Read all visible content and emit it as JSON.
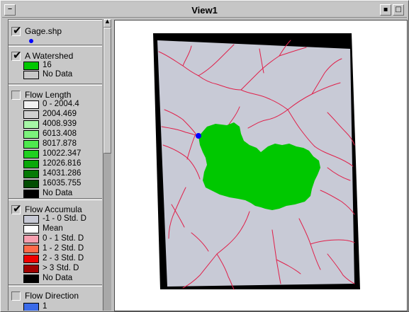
{
  "window": {
    "title": "View1"
  },
  "legend": {
    "gage": {
      "name": "Gage.shp",
      "checked": true,
      "symbol_color": "#0000ff"
    },
    "watershed": {
      "name": "A Watershed",
      "checked": true,
      "classes": [
        {
          "label": "16",
          "color": "#00c800"
        },
        {
          "label": "No Data",
          "color": "#c8c8c8"
        }
      ]
    },
    "flow_length": {
      "name": "Flow Length",
      "checked": false,
      "classes": [
        {
          "label": "0 - 2004.4",
          "color": "#f2f2f2"
        },
        {
          "label": "2004.469",
          "color": "#d0d0d0"
        },
        {
          "label": "4008.939",
          "color": "#a6f6a6"
        },
        {
          "label": "6013.408",
          "color": "#7cf27c"
        },
        {
          "label": "8017.878",
          "color": "#4ee84e"
        },
        {
          "label": "10022.347",
          "color": "#20d020"
        },
        {
          "label": "12026.816",
          "color": "#0aa80a"
        },
        {
          "label": "14031.286",
          "color": "#067a06"
        },
        {
          "label": "16035.755",
          "color": "#034e03"
        },
        {
          "label": "No Data",
          "color": "#000000"
        }
      ]
    },
    "flow_accumulation": {
      "name": "Flow Accumula",
      "checked": true,
      "classes": [
        {
          "label": "-1 - 0 Std. D",
          "color": "#c8cad6"
        },
        {
          "label": "Mean",
          "color": "#ffffff"
        },
        {
          "label": "0 - 1 Std. D",
          "color": "#f8a0b0"
        },
        {
          "label": "1 - 2 Std. D",
          "color": "#ff6a4a"
        },
        {
          "label": "2 - 3 Std. D",
          "color": "#ee0000"
        },
        {
          "label": "> 3 Std. D",
          "color": "#a00000"
        },
        {
          "label": "No Data",
          "color": "#000000"
        }
      ]
    },
    "flow_direction": {
      "name": "Flow Direction",
      "checked": false,
      "classes": [
        {
          "label": "1",
          "color": "#3a6ae8"
        }
      ]
    }
  },
  "colors": {
    "stream": "#e0204a",
    "raster_bg": "#c8cad6",
    "nodata_frame": "#000000",
    "gage_point": "#0000ff",
    "watershed": "#00c800"
  },
  "icons": {
    "system_menu": "dash-icon",
    "minimize": "minimize-icon",
    "maximize": "maximize-icon",
    "scroll_up": "arrow-up-icon"
  }
}
